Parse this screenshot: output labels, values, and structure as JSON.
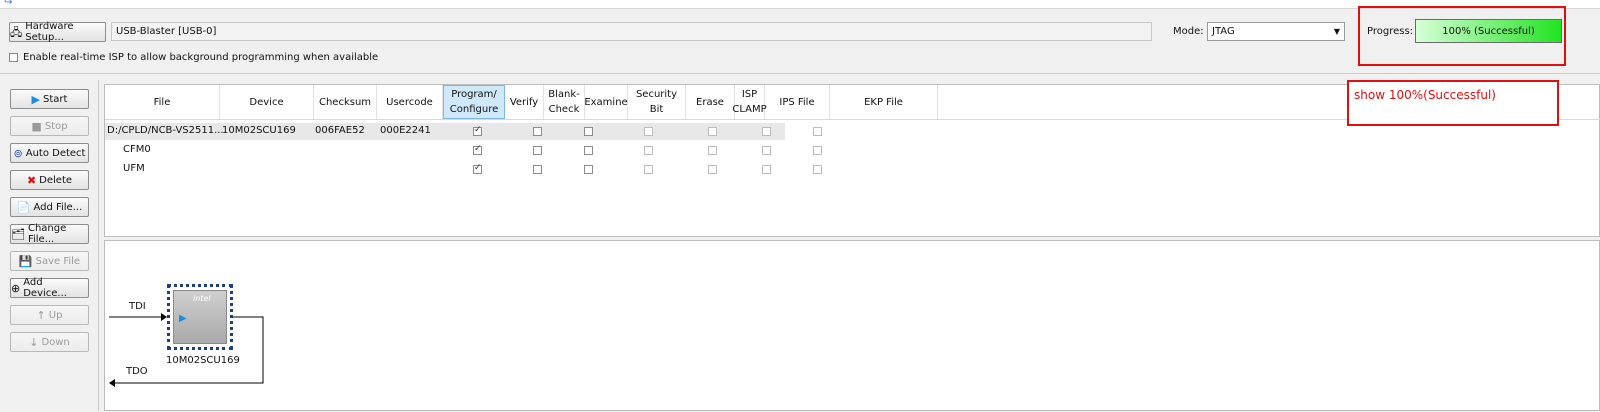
{
  "toolbar": {
    "hardware_setup_label": "Hardware Setup...",
    "hardware_value": "USB-Blaster [USB-0]",
    "mode_label": "Mode:",
    "mode_value": "JTAG",
    "progress_label": "Progress:",
    "progress_value": "100% (Successful)",
    "progress_fraction": 1.0,
    "isp_checkbox_label": "Enable real-time ISP to allow background programming when available"
  },
  "annotation": {
    "text": "show 100%(Successful)",
    "color": "#e01010"
  },
  "sidebar": {
    "buttons": [
      {
        "label": "Start",
        "icon": "play-icon",
        "enabled": true
      },
      {
        "label": "Stop",
        "icon": "stop-icon",
        "enabled": false
      },
      {
        "label": "Auto Detect",
        "icon": "binoculars-icon",
        "enabled": true
      },
      {
        "label": "Delete",
        "icon": "delete-x-icon",
        "enabled": true
      },
      {
        "label": "Add File...",
        "icon": "add-file-icon",
        "enabled": true
      },
      {
        "label": "Change File...",
        "icon": "change-file-icon",
        "enabled": true
      },
      {
        "label": "Save File",
        "icon": "save-icon",
        "enabled": false
      },
      {
        "label": "Add Device...",
        "icon": "add-device-icon",
        "enabled": true
      },
      {
        "label": "Up",
        "icon": "up-icon",
        "enabled": false
      },
      {
        "label": "Down",
        "icon": "down-icon",
        "enabled": false
      }
    ]
  },
  "table": {
    "headers": [
      "File",
      "Device",
      "Checksum",
      "Usercode",
      "Program/\nConfigure",
      "Verify",
      "Blank-\nCheck",
      "Examine",
      "Security\nBit",
      "Erase",
      "ISP\nCLAMP",
      "IPS File",
      "EKP File"
    ],
    "rows": [
      {
        "file": "D:/CPLD/NCB-VS2511...",
        "device": "10M02SCU169",
        "checksum": "006FAE52",
        "usercode": "000E2241",
        "checks": [
          true,
          false,
          false,
          false,
          false,
          false,
          false
        ],
        "dim": [
          false,
          false,
          false,
          true,
          true,
          true,
          true
        ]
      },
      {
        "file": "CFM0",
        "device": "",
        "checksum": "",
        "usercode": "",
        "checks": [
          true,
          false,
          false,
          false,
          false,
          false,
          false
        ],
        "dim": [
          false,
          false,
          false,
          true,
          true,
          true,
          true
        ]
      },
      {
        "file": "UFM",
        "device": "",
        "checksum": "",
        "usercode": "",
        "checks": [
          true,
          false,
          false,
          false,
          false,
          false,
          false
        ],
        "dim": [
          false,
          false,
          false,
          true,
          true,
          true,
          true
        ]
      }
    ]
  },
  "chain": {
    "tdi_label": "TDI",
    "tdo_label": "TDO",
    "device_label": "10M02SCU169",
    "chip_logo": "intel"
  },
  "colors": {
    "progress_fill": "#22e322",
    "highlight": "#e01010",
    "selected_column": "#cfe9fb"
  }
}
